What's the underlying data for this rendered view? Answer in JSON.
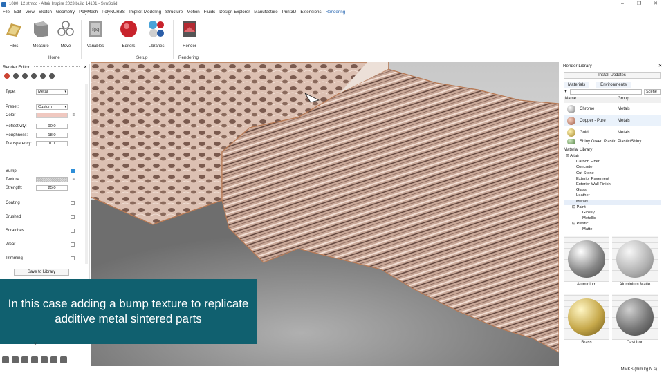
{
  "window": {
    "title": "1080_12.stmod - Altair Inspire 2023 build 14101 - SimSolid"
  },
  "menu": [
    "File",
    "Edit",
    "View",
    "Sketch",
    "Geometry",
    "PolyMesh",
    "PolyNURBS",
    "Implicit Modeling",
    "Structure",
    "Motion",
    "Fluids",
    "Design Explorer",
    "Manufacture",
    "Print3D",
    "Extensions",
    "Rendering"
  ],
  "ribbon": {
    "buttons": [
      {
        "label": "Files",
        "icon": "files-icon"
      },
      {
        "label": "Measure",
        "icon": "measure-icon"
      },
      {
        "label": "Move",
        "icon": "move-icon"
      },
      {
        "label": "Variables",
        "icon": "variables-icon"
      },
      {
        "label": "Editors",
        "icon": "editors-icon"
      },
      {
        "label": "Libraries",
        "icon": "libraries-icon"
      },
      {
        "label": "Render",
        "icon": "render-icon"
      }
    ],
    "groups": [
      "Home",
      "Setup",
      "Rendering"
    ]
  },
  "render_editor": {
    "title": "Render Editor",
    "type_label": "Type:",
    "type_value": "Metal",
    "preset_label": "Preset:",
    "preset_value": "Custom",
    "color_label": "Color",
    "reflectivity_label": "Reflectivity:",
    "reflectivity_value": "90.0",
    "roughness_label": "Roughness:",
    "roughness_value": "18.0",
    "transparency_label": "Transparency:",
    "transparency_value": "0.0",
    "bump_label": "Bump",
    "texture_label": "Texture",
    "strength_label": "Strength:",
    "strength_value": "25.0",
    "coating_label": "Coating",
    "brushed_label": "Brushed",
    "scratches_label": "Scratches",
    "wear_label": "Wear",
    "trimming_label": "Trimming",
    "save_label": "Save to Library",
    "colors": {
      "swatch": "#f0c8c0"
    }
  },
  "caption": "In this case adding a bump texture to replicate additive metal sintered parts",
  "axis_label": "X",
  "render_library": {
    "title": "Render Library",
    "install_label": "Install Updates",
    "tabs": [
      "Materials",
      "Environments"
    ],
    "scope": "Scene",
    "columns": [
      "Name",
      "Group"
    ],
    "rows": [
      {
        "name": "Chrome",
        "group": "Metals"
      },
      {
        "name": "Copper - Pure",
        "group": "Metals"
      },
      {
        "name": "Gold",
        "group": "Metals"
      },
      {
        "name": "Shiny Green Plastic",
        "group": "Plastic/Shiny"
      }
    ],
    "library_title": "Material Library",
    "tree": [
      "Altair",
      "Carbon Fiber",
      "Concrete",
      "Cut Stone",
      "Exterior Pavement",
      "Exterior Wall Finish",
      "Glass",
      "Leather",
      "Metals",
      "Paint",
      "Glossy",
      "Metallic",
      "Plastic",
      "Matte"
    ],
    "thumbs": [
      {
        "name": "Aluminium"
      },
      {
        "name": "Aluminium Matte"
      },
      {
        "name": "Brass"
      },
      {
        "name": "Cast Iron"
      }
    ]
  },
  "status": {
    "units": "MMKS (mm kg N s)"
  }
}
